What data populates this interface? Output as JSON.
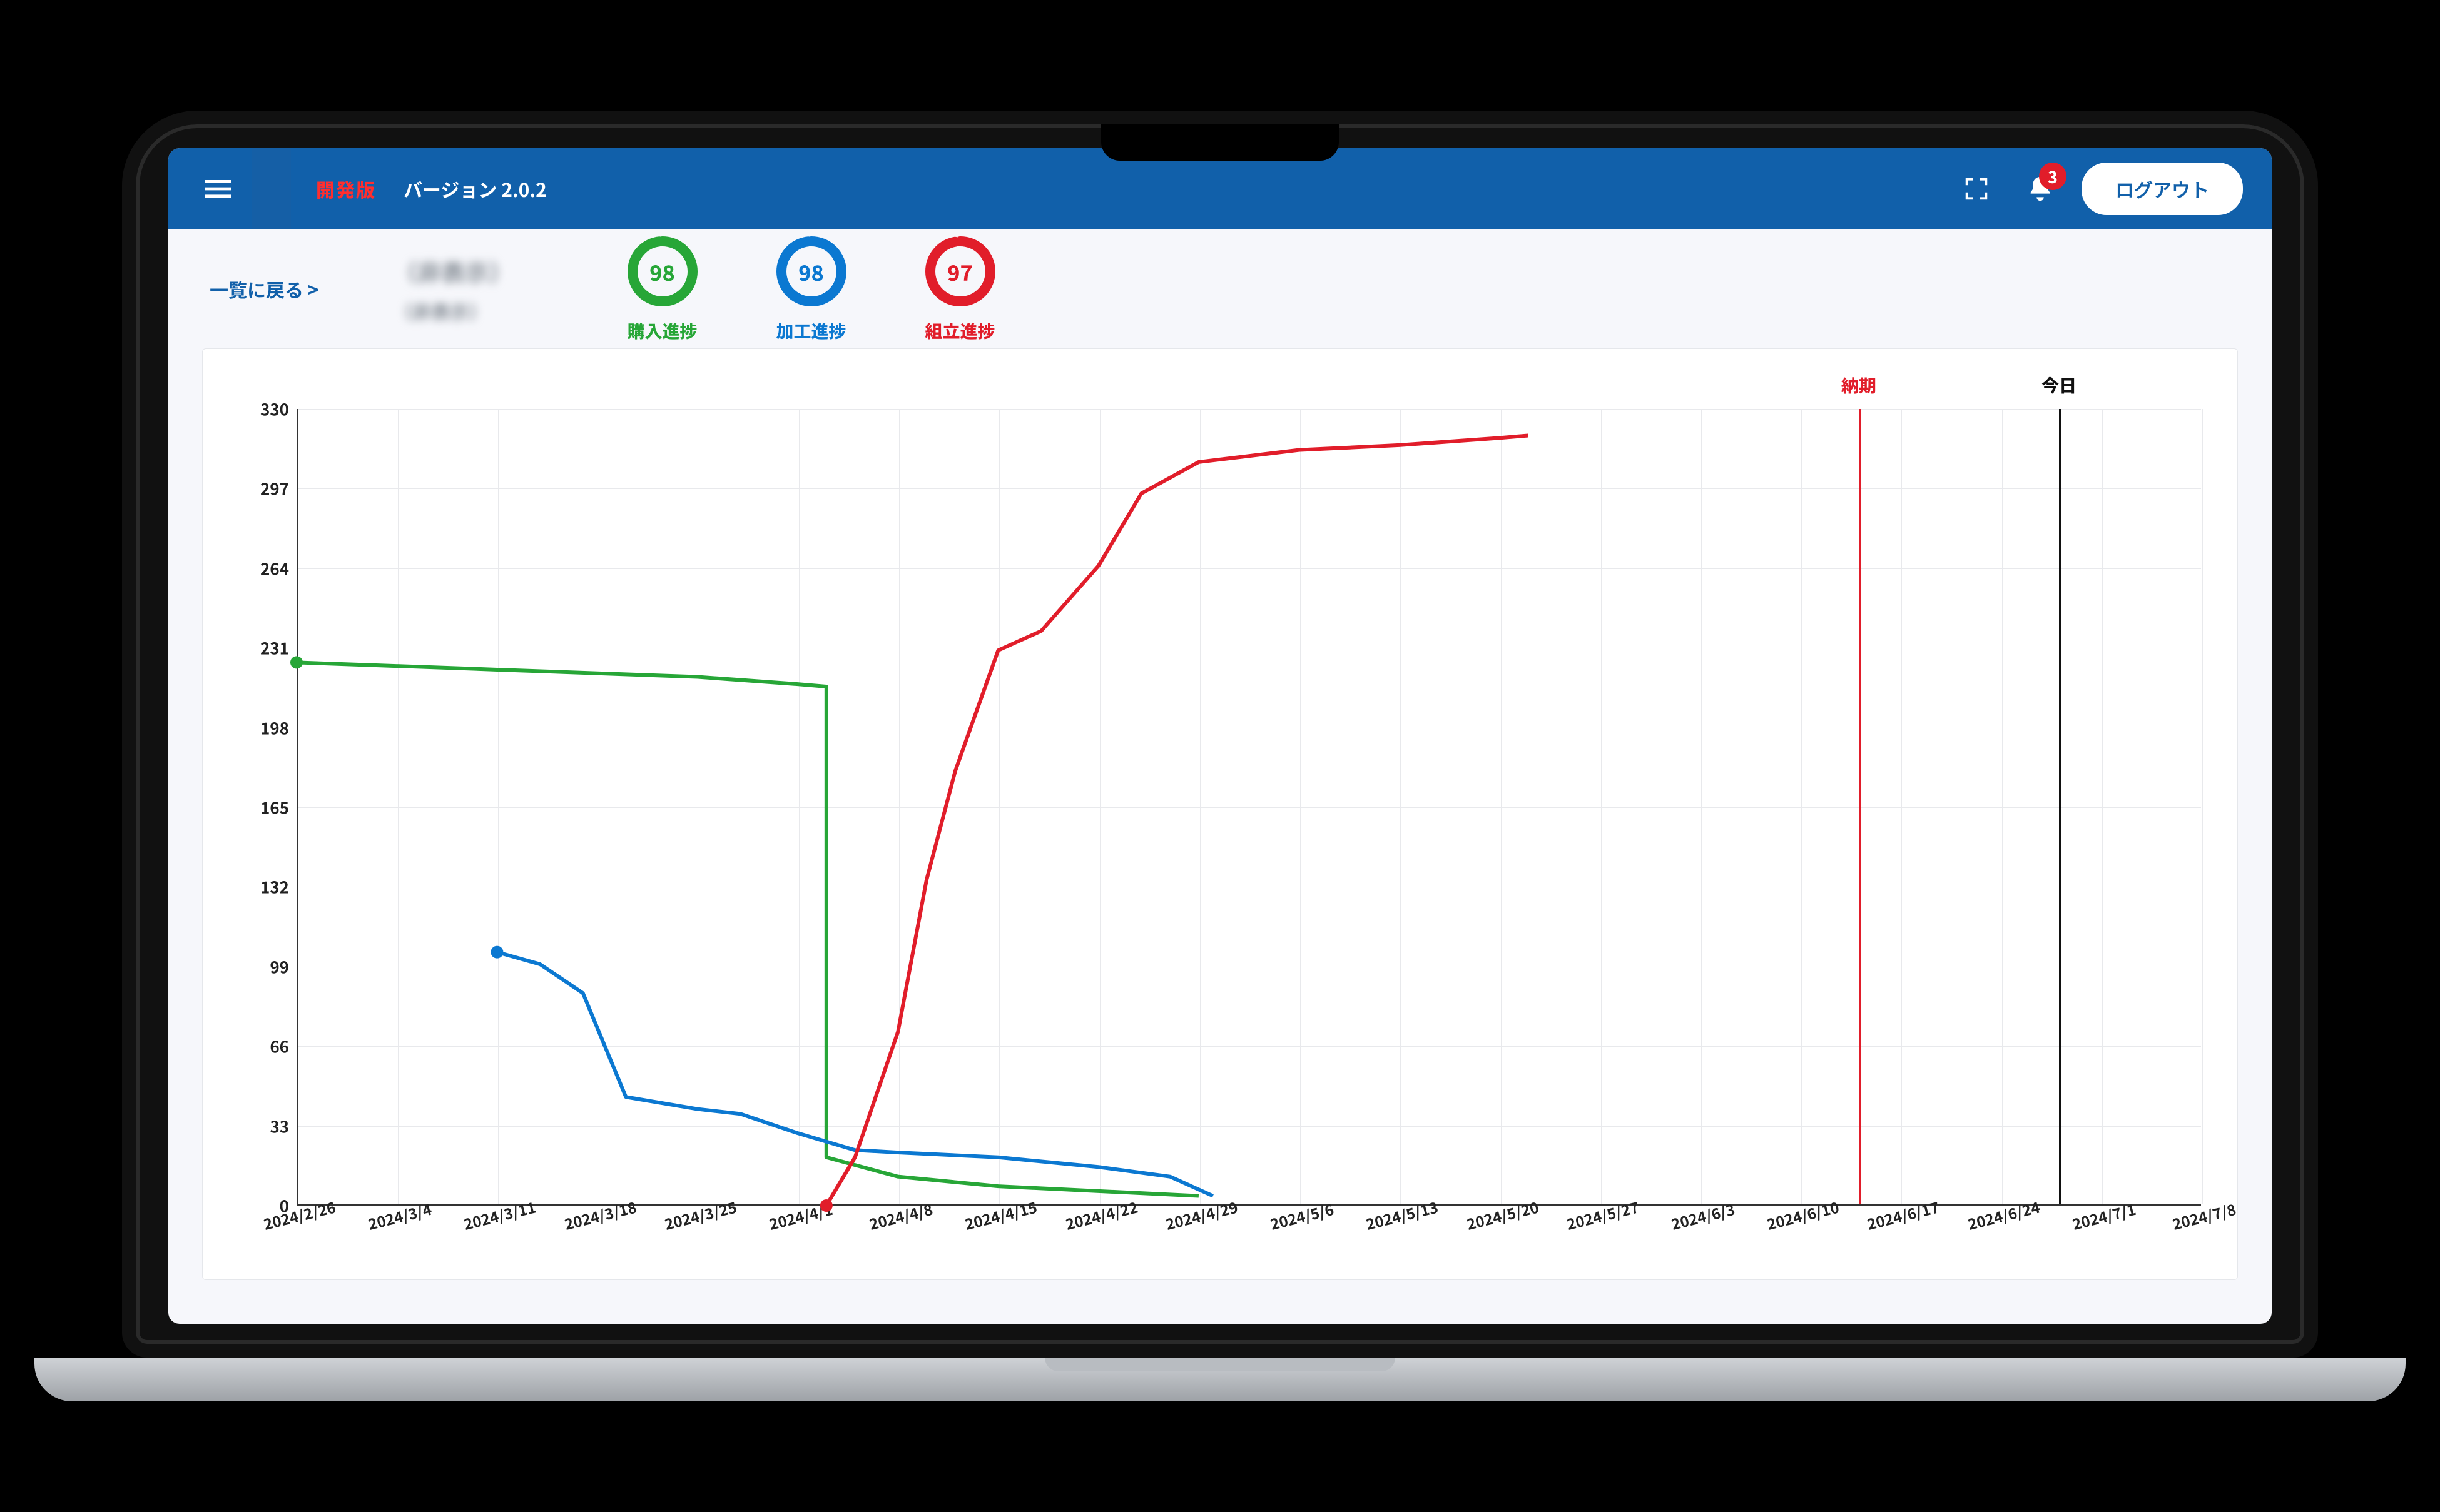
{
  "header": {
    "dev_label": "開発版",
    "version_label": "バージョン 2.0.2",
    "notification_count": "3",
    "logout_label": "ログアウト"
  },
  "subheader": {
    "back_label": "一覧に戻る >",
    "title1": "（非表示）",
    "title2": "（非表示）",
    "metrics": {
      "purchase": {
        "value": "98",
        "label": "購入進捗",
        "pct": 98,
        "color": "#27a637"
      },
      "machining": {
        "value": "98",
        "label": "加工進捗",
        "pct": 98,
        "color": "#0b78d1"
      },
      "assembly": {
        "value": "97",
        "label": "組立進捗",
        "pct": 97,
        "color": "#e11d2a"
      }
    }
  },
  "markers": {
    "deadline": {
      "label": "納期",
      "x": "2024/6/14",
      "color": "#e11d2a"
    },
    "today": {
      "label": "今日",
      "x": "2024/6/28",
      "color": "#111"
    }
  },
  "chart_data": {
    "type": "line",
    "title": "",
    "xlabel": "",
    "ylabel": "",
    "ylim": [
      0,
      330
    ],
    "y_ticks": [
      0,
      33,
      66,
      99,
      132,
      165,
      198,
      231,
      264,
      297,
      330
    ],
    "x_ticks": [
      "2024/2/26",
      "2024/3/4",
      "2024/3/11",
      "2024/3/18",
      "2024/3/25",
      "2024/4/1",
      "2024/4/8",
      "2024/4/15",
      "2024/4/22",
      "2024/4/29",
      "2024/5/6",
      "2024/5/13",
      "2024/5/20",
      "2024/5/27",
      "2024/6/3",
      "2024/6/10",
      "2024/6/17",
      "2024/6/24",
      "2024/7/1",
      "2024/7/8"
    ],
    "x_domain_days": [
      0,
      133
    ],
    "x_origin": "2024/2/26",
    "series": [
      {
        "name": "購入進捗",
        "color": "#27a637",
        "points": [
          {
            "x": "2024/2/26",
            "y": 225
          },
          {
            "x": "2024/3/11",
            "y": 222
          },
          {
            "x": "2024/3/25",
            "y": 219
          },
          {
            "x": "2024/4/1",
            "y": 216
          },
          {
            "x": "2024/4/3",
            "y": 215
          },
          {
            "x": "2024/4/3",
            "y": 20
          },
          {
            "x": "2024/4/8",
            "y": 12
          },
          {
            "x": "2024/4/15",
            "y": 8
          },
          {
            "x": "2024/4/22",
            "y": 6
          },
          {
            "x": "2024/4/29",
            "y": 4
          }
        ]
      },
      {
        "name": "加工進捗",
        "color": "#0b78d1",
        "points": [
          {
            "x": "2024/3/11",
            "y": 105
          },
          {
            "x": "2024/3/14",
            "y": 100
          },
          {
            "x": "2024/3/17",
            "y": 88
          },
          {
            "x": "2024/3/20",
            "y": 45
          },
          {
            "x": "2024/3/25",
            "y": 40
          },
          {
            "x": "2024/3/28",
            "y": 38
          },
          {
            "x": "2024/4/1",
            "y": 30
          },
          {
            "x": "2024/4/5",
            "y": 23
          },
          {
            "x": "2024/4/8",
            "y": 22
          },
          {
            "x": "2024/4/15",
            "y": 20
          },
          {
            "x": "2024/4/22",
            "y": 16
          },
          {
            "x": "2024/4/27",
            "y": 12
          },
          {
            "x": "2024/4/30",
            "y": 4
          }
        ]
      },
      {
        "name": "組立進捗",
        "color": "#e11d2a",
        "points": [
          {
            "x": "2024/4/3",
            "y": 0
          },
          {
            "x": "2024/4/5",
            "y": 20
          },
          {
            "x": "2024/4/8",
            "y": 72
          },
          {
            "x": "2024/4/10",
            "y": 135
          },
          {
            "x": "2024/4/12",
            "y": 180
          },
          {
            "x": "2024/4/15",
            "y": 230
          },
          {
            "x": "2024/4/18",
            "y": 238
          },
          {
            "x": "2024/4/22",
            "y": 265
          },
          {
            "x": "2024/4/25",
            "y": 295
          },
          {
            "x": "2024/4/29",
            "y": 308
          },
          {
            "x": "2024/5/6",
            "y": 313
          },
          {
            "x": "2024/5/13",
            "y": 315
          },
          {
            "x": "2024/5/20",
            "y": 318
          },
          {
            "x": "2024/5/22",
            "y": 319
          }
        ]
      }
    ]
  }
}
